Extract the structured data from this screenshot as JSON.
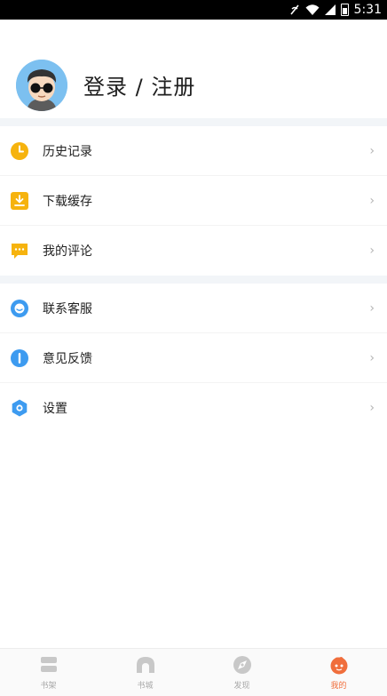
{
  "status_bar": {
    "time": "5:31",
    "icons": [
      "signal-mute-icon",
      "wifi-icon",
      "cell-signal-icon",
      "battery-icon"
    ]
  },
  "profile": {
    "avatar_icon": "avatar-face-icon",
    "login_label": "登录 / 注册"
  },
  "menu": {
    "group1": [
      {
        "label": "历史记录",
        "icon": "clock-icon",
        "color": "#F6B30E"
      },
      {
        "label": "下载缓存",
        "icon": "download-icon",
        "color": "#F6B30E"
      },
      {
        "label": "我的评论",
        "icon": "comment-icon",
        "color": "#F6B30E"
      }
    ],
    "group2": [
      {
        "label": "联系客服",
        "icon": "support-icon",
        "color": "#3D9BF0"
      },
      {
        "label": "意见反馈",
        "icon": "feedback-icon",
        "color": "#3D9BF0"
      },
      {
        "label": "设置",
        "icon": "settings-icon",
        "color": "#3D9BF0"
      }
    ]
  },
  "tabs": [
    {
      "label": "书架",
      "icon": "bookshelf-icon",
      "active": false
    },
    {
      "label": "书城",
      "icon": "bookstore-icon",
      "active": false
    },
    {
      "label": "发现",
      "icon": "discover-icon",
      "active": false
    },
    {
      "label": "我的",
      "icon": "profile-tab-icon",
      "active": true
    }
  ],
  "colors": {
    "accent": "#F06E3C",
    "yellow_icon": "#F6B30E",
    "blue_icon": "#3D9BF0",
    "inactive_tab": "#C8C8C8"
  }
}
